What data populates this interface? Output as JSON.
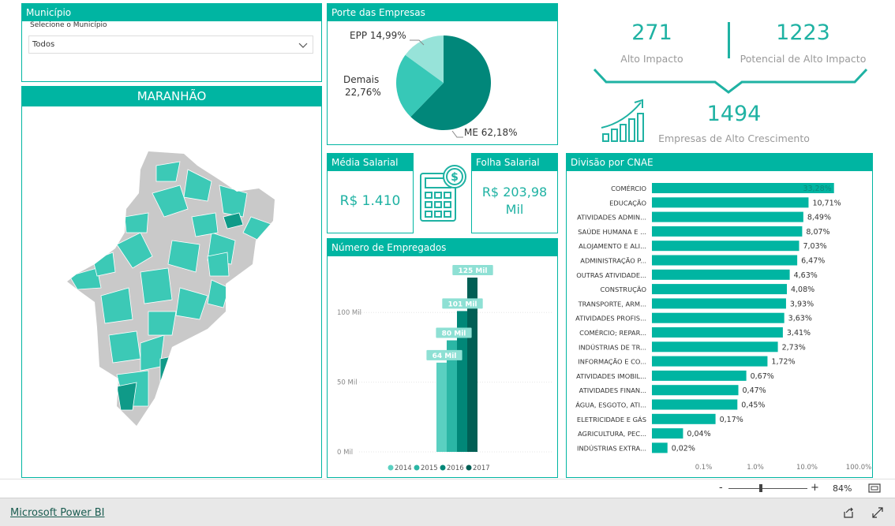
{
  "municipio": {
    "title": "Município",
    "label": "Selecione o Município",
    "value": "Todos"
  },
  "map": {
    "title": "MARANHÃO"
  },
  "porte": {
    "title": "Porte das Empresas",
    "labels": {
      "epp": "EPP 14,99%",
      "demais_name": "Demais",
      "demais_pct": "22,76%",
      "me": "ME 62,18%"
    },
    "colors": {
      "me": "#01877a",
      "demais": "#37c8b7",
      "epp": "#97e3d9"
    }
  },
  "kpis": {
    "alto_impacto": {
      "value": "271",
      "label": "Alto Impacto"
    },
    "potencial": {
      "value": "1223",
      "label": "Potencial de Alto Impacto"
    },
    "crescimento": {
      "value": "1494",
      "label": "Empresas de Alto Crescimento"
    }
  },
  "media_salarial": {
    "title": "Média Salarial",
    "value": "R$ 1.410"
  },
  "folha_salarial": {
    "title": "Folha Salarial",
    "value_line1": "R$ 203,98",
    "value_line2": "Mil"
  },
  "empregados": {
    "title": "Número de Empregados",
    "yticks": [
      "100 Mil",
      "50 Mil",
      "0 Mil"
    ],
    "bar_labels": [
      "64 Mil",
      "80 Mil",
      "101 Mil",
      "125 Mil"
    ],
    "legend": [
      "2014",
      "2015",
      "2016",
      "2017"
    ]
  },
  "cnae": {
    "title": "Divisão por CNAE",
    "xticks": [
      "0.1%",
      "1.0%",
      "10.0%",
      "100.0%"
    ]
  },
  "zoom": {
    "minus": "-",
    "plus": "+",
    "percent": "84%"
  },
  "footer": {
    "brand": "Microsoft Power BI"
  },
  "chart_data": [
    {
      "type": "pie",
      "title": "Porte das Empresas",
      "categories": [
        "ME",
        "Demais",
        "EPP"
      ],
      "values": [
        62.18,
        22.76,
        14.99
      ]
    },
    {
      "type": "bar",
      "title": "Número de Empregados",
      "categories": [
        "2014",
        "2015",
        "2016",
        "2017"
      ],
      "values": [
        64,
        80,
        101,
        125
      ],
      "ylabel": "",
      "ylim": [
        0,
        125
      ],
      "colors": [
        "#5ad0c1",
        "#2bb6a5",
        "#018778",
        "#015f55"
      ]
    },
    {
      "type": "bar",
      "title": "Divisão por CNAE",
      "categories": [
        "COMÉRCIO",
        "EDUCAÇÃO",
        "ATIVIDADES ADMIN...",
        "SAÚDE HUMANA E ...",
        "ALOJAMENTO E ALI...",
        "ADMINISTRAÇÃO P...",
        "OUTRAS ATIVIDADE...",
        "CONSTRUÇÃO",
        "TRANSPORTE, ARM...",
        "ATIVIDADES PROFIS...",
        "COMÉRCIO; REPAR...",
        "INDÚSTRIAS DE TR...",
        "INFORMAÇÃO E CO...",
        "ATIVIDADES IMOBIL...",
        "ATIVIDADES FINAN...",
        "ÁGUA, ESGOTO, ATI...",
        "ELETRICIDADE E GÁS",
        "AGRICULTURA, PEC...",
        "INDÚSTRIAS EXTRA..."
      ],
      "values": [
        33.28,
        10.71,
        8.49,
        8.07,
        7.03,
        6.47,
        4.63,
        4.08,
        3.93,
        3.63,
        3.41,
        2.73,
        1.72,
        0.67,
        0.47,
        0.45,
        0.17,
        0.04,
        0.02
      ],
      "value_labels": [
        "33,28%",
        "10,71%",
        "8,49%",
        "8,07%",
        "7,03%",
        "6,47%",
        "4,63%",
        "4,08%",
        "3,93%",
        "3,63%",
        "3,41%",
        "2,73%",
        "1,72%",
        "0,67%",
        "0,47%",
        "0,45%",
        "0,17%",
        "0,04%",
        "0,02%"
      ],
      "xscale": "log"
    }
  ]
}
